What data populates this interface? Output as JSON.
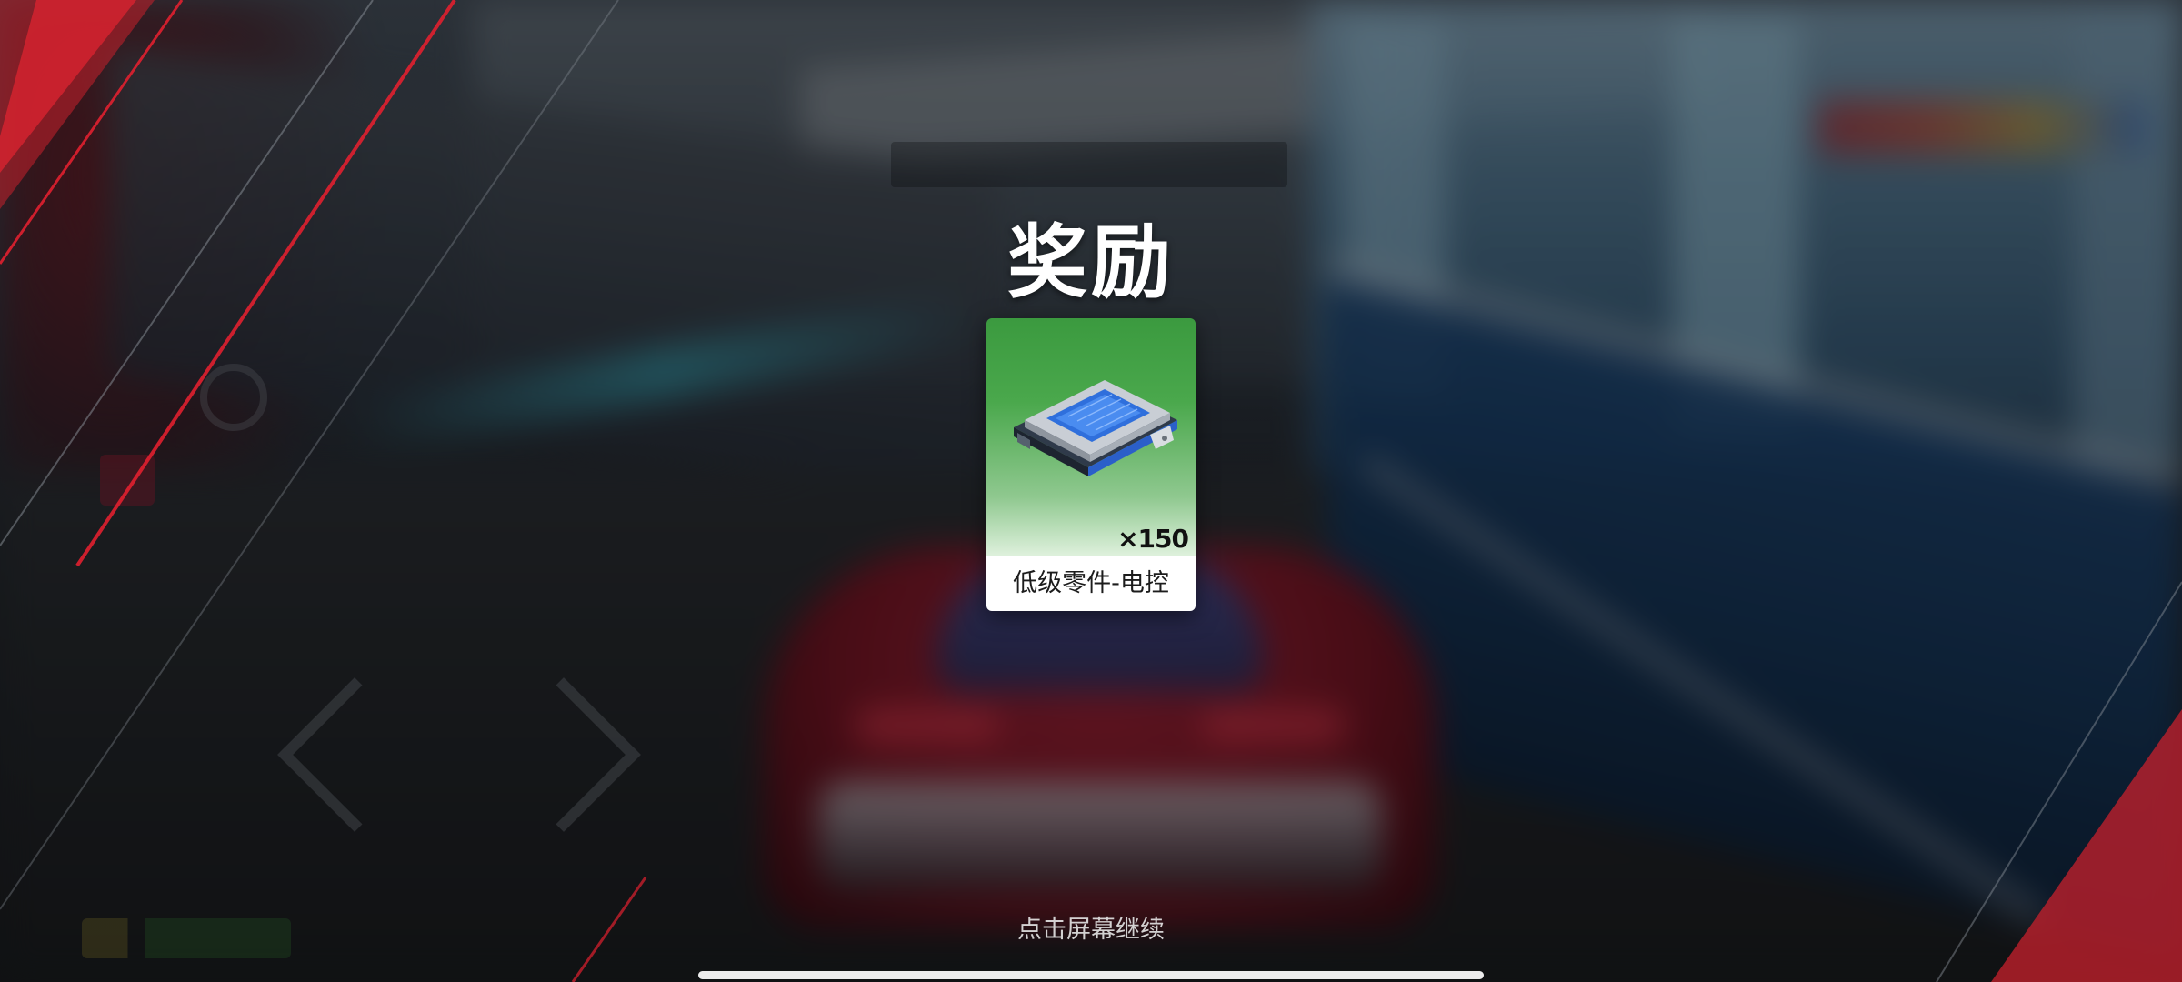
{
  "dialog": {
    "title": "奖励",
    "continue_hint": "点击屏幕继续"
  },
  "reward": {
    "name": "低级零件-电控",
    "quantity_label": "×150",
    "icon": "electronic-control-part-icon",
    "rarity_color": "#3b9a3f"
  },
  "theme": {
    "accent_red": "#e0202f",
    "text_color": "#ffffff"
  }
}
